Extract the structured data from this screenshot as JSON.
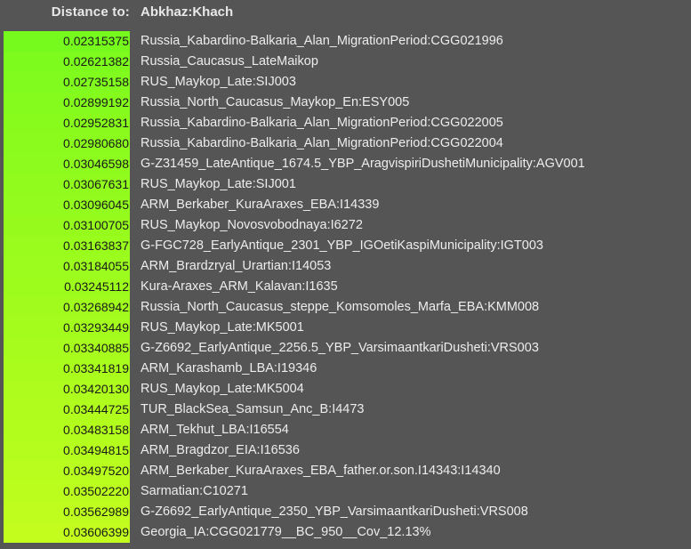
{
  "header": {
    "label": "Distance to:",
    "target": "Abkhaz:Khach"
  },
  "row_colors": [
    "#76fa1d",
    "#7cfb1d",
    "#80fb1d",
    "#85fb1d",
    "#88fb1d",
    "#8afb1d",
    "#8dfb1d",
    "#90fb1d",
    "#93fb1d",
    "#96fb1d",
    "#99fc1d",
    "#9bfc1d",
    "#9efc1d",
    "#a1fc1d",
    "#a4fc1d",
    "#a7fc1d",
    "#aafc1d",
    "#adfc1d",
    "#b0fc1d",
    "#b3fd1d",
    "#b5fd1d",
    "#b8fd1d",
    "#bbfd1d",
    "#befd1d",
    "#c2fd1d"
  ],
  "rows": [
    {
      "distance": "0.02315375",
      "name": "Russia_Kabardino-Balkaria_Alan_MigrationPeriod:CGG021996"
    },
    {
      "distance": "0.02621382",
      "name": "Russia_Caucasus_LateMaikop"
    },
    {
      "distance": "0.02735158",
      "name": "RUS_Maykop_Late:SIJ003"
    },
    {
      "distance": "0.02899192",
      "name": "Russia_North_Caucasus_Maykop_En:ESY005"
    },
    {
      "distance": "0.02952831",
      "name": "Russia_Kabardino-Balkaria_Alan_MigrationPeriod:CGG022005"
    },
    {
      "distance": "0.02980680",
      "name": "Russia_Kabardino-Balkaria_Alan_MigrationPeriod:CGG022004"
    },
    {
      "distance": "0.03046598",
      "name": "G-Z31459_LateAntique_1674.5_YBP_AragvispiriDushetiMunicipality:AGV001"
    },
    {
      "distance": "0.03067631",
      "name": "RUS_Maykop_Late:SIJ001"
    },
    {
      "distance": "0.03096045",
      "name": "ARM_Berkaber_KuraAraxes_EBA:I14339"
    },
    {
      "distance": "0.03100705",
      "name": "RUS_Maykop_Novosvobodnaya:I6272"
    },
    {
      "distance": "0.03163837",
      "name": "G-FGC728_EarlyAntique_2301_YBP_IGOetiKaspiMunicipality:IGT003"
    },
    {
      "distance": "0.03184055",
      "name": "ARM_Brardzryal_Urartian:I14053"
    },
    {
      "distance": "0.03245112",
      "name": "Kura-Araxes_ARM_Kalavan:I1635"
    },
    {
      "distance": "0.03268942",
      "name": "Russia_North_Caucasus_steppe_Komsomoles_Marfa_EBA:KMM008"
    },
    {
      "distance": "0.03293449",
      "name": "RUS_Maykop_Late:MK5001"
    },
    {
      "distance": "0.03340885",
      "name": "G-Z6692_EarlyAntique_2256.5_YBP_VarsimaantkariDusheti:VRS003"
    },
    {
      "distance": "0.03341819",
      "name": "ARM_Karashamb_LBA:I19346"
    },
    {
      "distance": "0.03420130",
      "name": "RUS_Maykop_Late:MK5004"
    },
    {
      "distance": "0.03444725",
      "name": "TUR_BlackSea_Samsun_Anc_B:I4473"
    },
    {
      "distance": "0.03483158",
      "name": "ARM_Tekhut_LBA:I16554"
    },
    {
      "distance": "0.03494815",
      "name": "ARM_Bragdzor_EIA:I16536"
    },
    {
      "distance": "0.03497520",
      "name": "ARM_Berkaber_KuraAraxes_EBA_father.or.son.I14343:I14340"
    },
    {
      "distance": "0.03502220",
      "name": "Sarmatian:C10271"
    },
    {
      "distance": "0.03562989",
      "name": "G-Z6692_EarlyAntique_2350_YBP_VarsimaantkariDusheti:VRS008"
    },
    {
      "distance": "0.03606399",
      "name": "Georgia_IA:CGG021779__BC_950__Cov_12.13%"
    }
  ]
}
